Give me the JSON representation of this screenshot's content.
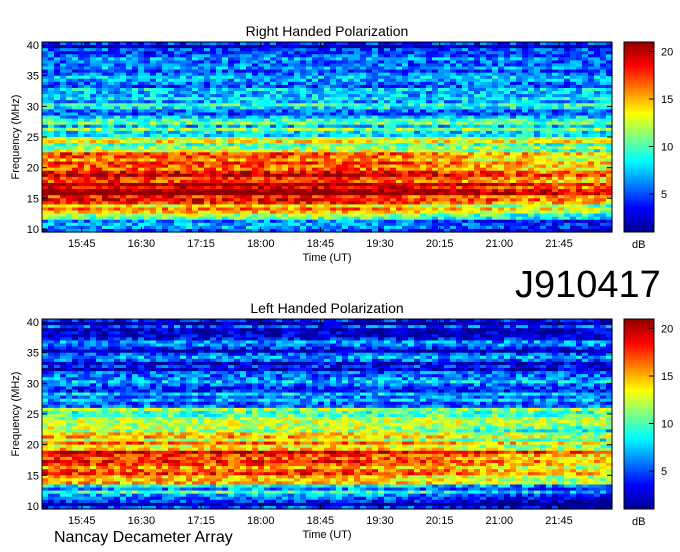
{
  "observation_id": "J910417",
  "instrument": "Nancay Decameter Array",
  "colors": {
    "colormap": [
      "#00008f",
      "#0000ff",
      "#0080ff",
      "#00ffff",
      "#80ff80",
      "#ffff00",
      "#ff8000",
      "#ff0000",
      "#8f0000"
    ]
  },
  "chart_data": [
    {
      "type": "heatmap",
      "title": "Right Handed Polarization",
      "xlabel": "Time (UT)",
      "ylabel": "Frequency (MHz)",
      "x_ticks": [
        "15:45",
        "16:30",
        "17:15",
        "18:00",
        "18:45",
        "19:30",
        "20:15",
        "21:00",
        "21:45"
      ],
      "x_tick_minutes": [
        945,
        990,
        1035,
        1080,
        1125,
        1170,
        1215,
        1260,
        1305
      ],
      "xlim_minutes": [
        915,
        1345
      ],
      "y_ticks": [
        10,
        15,
        20,
        25,
        30,
        35,
        40
      ],
      "ylim": [
        9.5,
        40.5
      ],
      "colorbar": {
        "label": "dB",
        "ticks": [
          5,
          10,
          15,
          20
        ],
        "range": [
          1,
          21
        ]
      },
      "levels_by_frequency": [
        {
          "freq": 10,
          "db": 4
        },
        {
          "freq": 12,
          "db": 9
        },
        {
          "freq": 14,
          "db": 17
        },
        {
          "freq": 16,
          "db": 20
        },
        {
          "freq": 18,
          "db": 20
        },
        {
          "freq": 20,
          "db": 18
        },
        {
          "freq": 22,
          "db": 15
        },
        {
          "freq": 24,
          "db": 12
        },
        {
          "freq": 26,
          "db": 10
        },
        {
          "freq": 28,
          "db": 8
        },
        {
          "freq": 30,
          "db": 7
        },
        {
          "freq": 32,
          "db": 6
        },
        {
          "freq": 34,
          "db": 5
        },
        {
          "freq": 36,
          "db": 5
        },
        {
          "freq": 38,
          "db": 4
        },
        {
          "freq": 40,
          "db": 3
        }
      ]
    },
    {
      "type": "heatmap",
      "title": "Left Handed Polarization",
      "xlabel": "Time (UT)",
      "ylabel": "Frequency (MHz)",
      "x_ticks": [
        "15:45",
        "16:30",
        "17:15",
        "18:00",
        "18:45",
        "19:30",
        "20:15",
        "21:00",
        "21:45"
      ],
      "x_tick_minutes": [
        945,
        990,
        1035,
        1080,
        1125,
        1170,
        1215,
        1260,
        1305
      ],
      "xlim_minutes": [
        915,
        1345
      ],
      "y_ticks": [
        10,
        15,
        20,
        25,
        30,
        35,
        40
      ],
      "ylim": [
        9.5,
        40.5
      ],
      "colorbar": {
        "label": "dB",
        "ticks": [
          5,
          10,
          15,
          20
        ],
        "range": [
          1,
          21
        ]
      },
      "levels_by_frequency": [
        {
          "freq": 10,
          "db": 3
        },
        {
          "freq": 12,
          "db": 7
        },
        {
          "freq": 14,
          "db": 13
        },
        {
          "freq": 16,
          "db": 18
        },
        {
          "freq": 18,
          "db": 19
        },
        {
          "freq": 20,
          "db": 16
        },
        {
          "freq": 22,
          "db": 13
        },
        {
          "freq": 24,
          "db": 11
        },
        {
          "freq": 26,
          "db": 9
        },
        {
          "freq": 28,
          "db": 7
        },
        {
          "freq": 30,
          "db": 6
        },
        {
          "freq": 32,
          "db": 5
        },
        {
          "freq": 34,
          "db": 5
        },
        {
          "freq": 36,
          "db": 4
        },
        {
          "freq": 38,
          "db": 4
        },
        {
          "freq": 40,
          "db": 3
        }
      ]
    }
  ]
}
